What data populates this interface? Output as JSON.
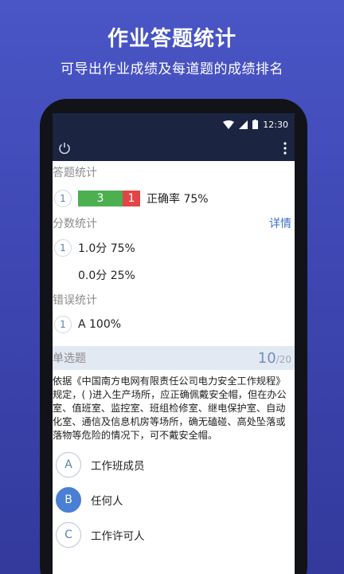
{
  "promo": {
    "title": "作业答题统计",
    "subtitle": "可导出作业成绩及每道题的成绩排名"
  },
  "statusbar": {
    "time": "12:30",
    "icons": [
      "wifi-icon",
      "signal-icon",
      "battery-icon"
    ]
  },
  "appbar": {
    "icons": [
      "power-icon",
      "more-vert-icon"
    ]
  },
  "answer_stats": {
    "label": "答题统计",
    "rows": [
      {
        "index": "1",
        "correct": "3",
        "wrong": "1",
        "rate": "正确率 75%"
      }
    ]
  },
  "score_stats": {
    "label": "分数统计",
    "detail": "详情",
    "rows": [
      {
        "index": "1",
        "text": "1.0分 75%"
      },
      {
        "index": "",
        "text": "0.0分 25%"
      }
    ]
  },
  "error_stats": {
    "label": "错误统计",
    "rows": [
      {
        "index": "1",
        "text": "A 100%"
      }
    ]
  },
  "question_bar": {
    "type": "单选题",
    "current": "10",
    "total": "/20"
  },
  "question": {
    "text": "依据《中国南方电网有限责任公司电力安全工作规程》规定，(  )进入生产场所，应正确佩戴安全帽，但在办公室、值班室、监控室、班组检修室、继电保护室、自动化室、通信及信息机房等场所，确无磕碰、高处坠落或落物等危险的情况下，可不戴安全帽。",
    "options": [
      {
        "letter": "A",
        "text": "工作班成员",
        "selected": false
      },
      {
        "letter": "B",
        "text": "任何人",
        "selected": true
      },
      {
        "letter": "C",
        "text": "工作许可人",
        "selected": false
      }
    ]
  },
  "colors": {
    "bg": "#4a56c6",
    "bar": "#1b2440",
    "correct": "#4caf50",
    "wrong": "#e04646",
    "accent": "#4a7fd6"
  }
}
